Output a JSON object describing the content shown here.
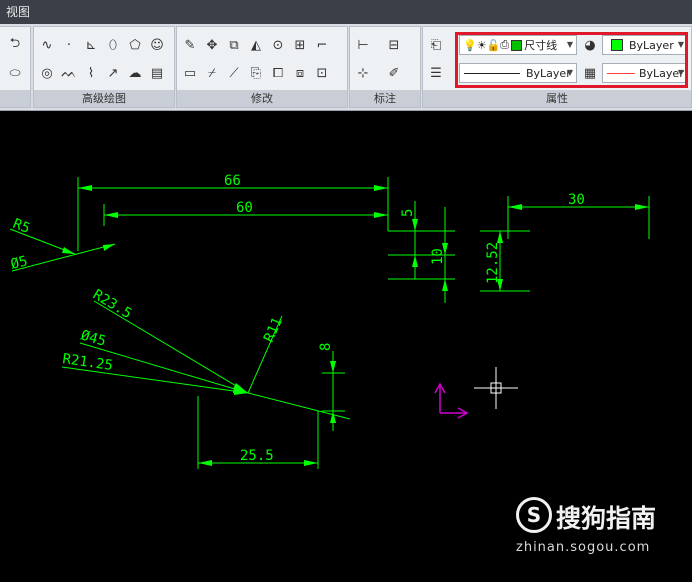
{
  "menu": {
    "view_label": "视图"
  },
  "panels": {
    "draw_label": "高级绘图",
    "modify_label": "修改",
    "annotate_label": "标注",
    "properties_label": "属性"
  },
  "properties": {
    "layer_name": "尺寸线",
    "layer_color": "#00c000",
    "color_value": "ByLayer",
    "color_swatch": "#00ff00",
    "linetype_value": "ByLayer",
    "lineweight_value": "ByLayer",
    "lineweight_color": "#ff4040"
  },
  "drawing": {
    "dimensions": [
      "66",
      "60",
      "30",
      "5",
      "10",
      "12.52",
      "R5",
      "Ø5",
      "R23.5",
      "Ø45",
      "R21.25",
      "R11",
      "8",
      "25.5"
    ],
    "dimension_color": "#00ff00",
    "ucs_color": "#d000d0",
    "crosshair_color": "#ffffff"
  },
  "watermark": {
    "brand": "搜狗指南",
    "url": "zhinan.sogou.com",
    "logo_glyph": "S"
  }
}
